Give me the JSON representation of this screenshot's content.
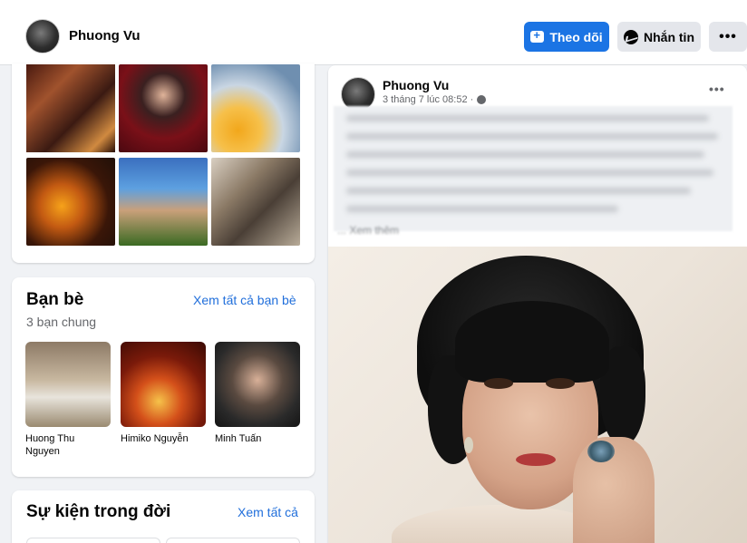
{
  "header": {
    "profile_name": "Phuong Vu",
    "follow_label": "Theo dõi",
    "message_label": "Nhắn tin",
    "more_label": "•••"
  },
  "friends": {
    "title": "Bạn bè",
    "see_all_label": "Xem tất cả bạn bè",
    "mutual_count": "3 bạn chung",
    "items": [
      {
        "name": "Huong Thu Nguyen"
      },
      {
        "name": "Himiko Nguyễn"
      },
      {
        "name": "Minh Tuấn"
      }
    ]
  },
  "life_events": {
    "title": "Sự kiện trong đời",
    "see_all_label": "Xem tất cả"
  },
  "post": {
    "author": "Phuong Vu",
    "time": "3 tháng 7 lúc 08:52 ·",
    "more_label": "•••",
    "see_more_blurred": "... Xem thêm"
  },
  "colors": {
    "accent": "#1b74e4",
    "link": "#216fdb",
    "background": "#f0f2f5"
  }
}
